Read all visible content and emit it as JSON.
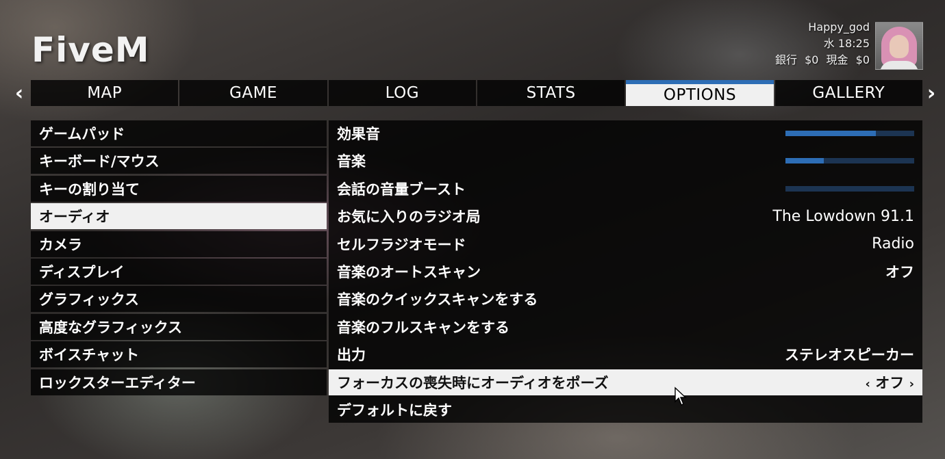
{
  "app": {
    "title": "FiveM"
  },
  "player": {
    "name": "Happy_god",
    "datetime": "水 18:25",
    "bank_label": "銀行",
    "bank_value": "$0",
    "cash_label": "現金",
    "cash_value": "$0"
  },
  "nav": {
    "left_arrow": "‹",
    "right_arrow": "›",
    "tabs": [
      {
        "label": "MAP"
      },
      {
        "label": "GAME"
      },
      {
        "label": "LOG"
      },
      {
        "label": "STATS"
      },
      {
        "label": "OPTIONS",
        "active": true
      },
      {
        "label": "GALLERY"
      }
    ]
  },
  "sidebar": {
    "items": [
      {
        "label": "ゲームパッド"
      },
      {
        "label": "キーボード/マウス"
      },
      {
        "label": "キーの割り当て"
      },
      {
        "label": "オーディオ",
        "active": true
      },
      {
        "label": "カメラ"
      },
      {
        "label": "ディスプレイ"
      },
      {
        "label": "グラフィックス"
      },
      {
        "label": "高度なグラフィックス"
      },
      {
        "label": "ボイスチャット"
      },
      {
        "label": "ロックスターエディター"
      }
    ]
  },
  "settings": {
    "rows": [
      {
        "label": "効果音",
        "type": "slider",
        "level": 0.7
      },
      {
        "label": "音楽",
        "type": "slider",
        "level": 0.3
      },
      {
        "label": "会話の音量ブースト",
        "type": "slider",
        "level": 0.0
      },
      {
        "label": "お気に入りのラジオ局",
        "value": "The Lowdown 91.1"
      },
      {
        "label": "セルフラジオモード",
        "value": "Radio"
      },
      {
        "label": "音楽のオートスキャン",
        "value": "オフ"
      },
      {
        "label": "音楽のクイックスキャンをする"
      },
      {
        "label": "音楽のフルスキャンをする"
      },
      {
        "label": "出力",
        "value": "ステレオスピーカー"
      },
      {
        "label": "フォーカスの喪失時にオーディオをポーズ",
        "value": "オフ",
        "active": true
      },
      {
        "label": "デフォルトに戻す"
      }
    ]
  },
  "colors": {
    "accent": "#2d6db5",
    "slider_track": "#1c3452",
    "selected_bg": "#f0f0f0"
  }
}
